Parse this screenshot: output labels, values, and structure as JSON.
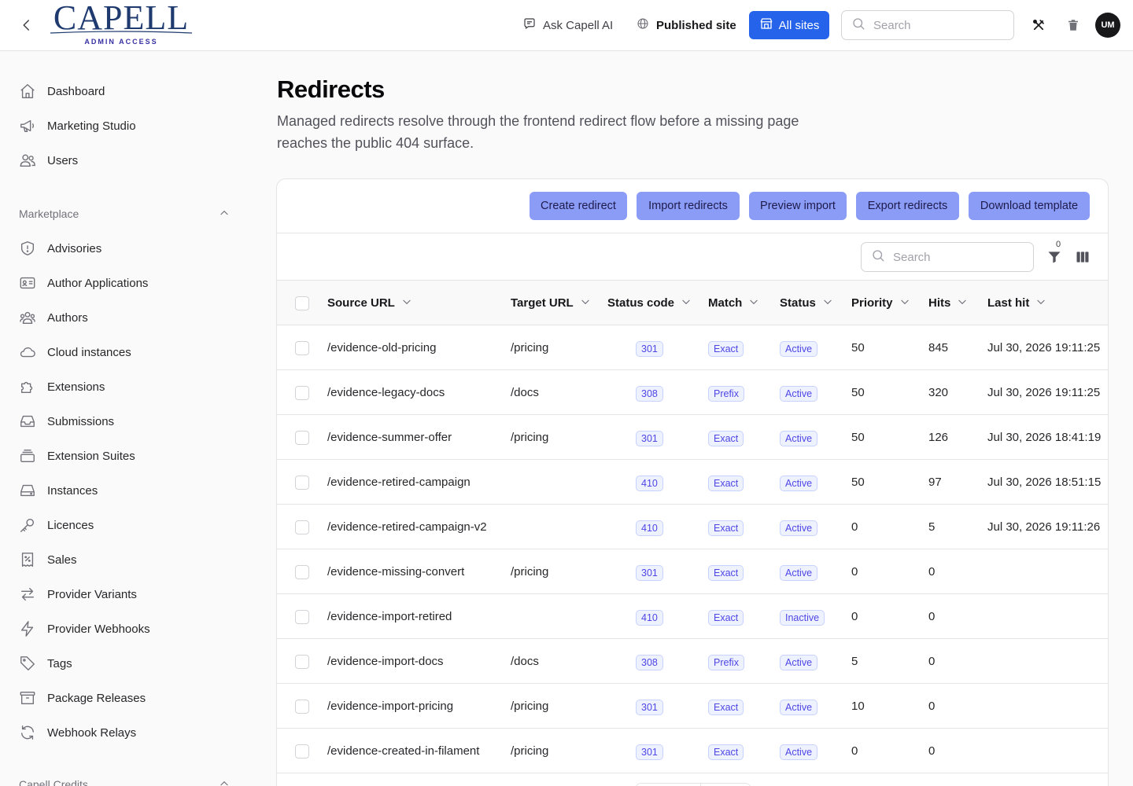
{
  "header": {
    "logo_text": "CAPELL",
    "logo_sub": "ADMIN ACCESS",
    "ask_ai_label": "Ask Capell AI",
    "published_site_label": "Published site",
    "all_sites_label": "All sites",
    "search_placeholder": "Search",
    "avatar_initials": "UM"
  },
  "sidebar": {
    "top_items": [
      {
        "label": "Dashboard",
        "icon": "home-icon"
      },
      {
        "label": "Marketing Studio",
        "icon": "megaphone-icon"
      },
      {
        "label": "Users",
        "icon": "users-icon"
      }
    ],
    "group_label": "Marketplace",
    "group_items": [
      {
        "label": "Advisories",
        "icon": "shield-icon"
      },
      {
        "label": "Author Applications",
        "icon": "id-card-icon"
      },
      {
        "label": "Authors",
        "icon": "user-group-icon"
      },
      {
        "label": "Cloud instances",
        "icon": "cloud-icon"
      },
      {
        "label": "Extensions",
        "icon": "puzzle-icon"
      },
      {
        "label": "Submissions",
        "icon": "inbox-icon"
      },
      {
        "label": "Extension Suites",
        "icon": "stack-icon"
      },
      {
        "label": "Instances",
        "icon": "server-icon"
      },
      {
        "label": "Licences",
        "icon": "key-icon"
      },
      {
        "label": "Sales",
        "icon": "receipt-percent-icon"
      },
      {
        "label": "Provider Variants",
        "icon": "arrows-right-left-icon"
      },
      {
        "label": "Provider Webhooks",
        "icon": "bolt-icon"
      },
      {
        "label": "Tags",
        "icon": "tag-icon"
      },
      {
        "label": "Package Releases",
        "icon": "archive-box-icon"
      },
      {
        "label": "Webhook Relays",
        "icon": "refresh-icon"
      }
    ],
    "group2_label": "Capell Credits"
  },
  "page": {
    "title": "Redirects",
    "description": "Managed redirects resolve through the frontend redirect flow before a missing page reaches the public 404 surface."
  },
  "actions": {
    "create": "Create redirect",
    "import": "Import redirects",
    "preview": "Preview import",
    "export": "Export redirects",
    "template": "Download template"
  },
  "table": {
    "search_placeholder": "Search",
    "filter_count": "0",
    "columns": [
      "Source URL",
      "Target URL",
      "Status code",
      "Match",
      "Status",
      "Priority",
      "Hits",
      "Last hit"
    ],
    "rows": [
      {
        "source": "/evidence-old-pricing",
        "target": "/pricing",
        "code": "301",
        "match": "Exact",
        "status": "Active",
        "priority": "50",
        "hits": "845",
        "last_hit": "Jul 30, 2026 19:11:25"
      },
      {
        "source": "/evidence-legacy-docs",
        "target": "/docs",
        "code": "308",
        "match": "Prefix",
        "status": "Active",
        "priority": "50",
        "hits": "320",
        "last_hit": "Jul 30, 2026 19:11:25"
      },
      {
        "source": "/evidence-summer-offer",
        "target": "/pricing",
        "code": "301",
        "match": "Exact",
        "status": "Active",
        "priority": "50",
        "hits": "126",
        "last_hit": "Jul 30, 2026 18:41:19"
      },
      {
        "source": "/evidence-retired-campaign",
        "target": "",
        "code": "410",
        "match": "Exact",
        "status": "Active",
        "priority": "50",
        "hits": "97",
        "last_hit": "Jul 30, 2026 18:51:15"
      },
      {
        "source": "/evidence-retired-campaign-v2",
        "target": "",
        "code": "410",
        "match": "Exact",
        "status": "Active",
        "priority": "0",
        "hits": "5",
        "last_hit": "Jul 30, 2026 19:11:26"
      },
      {
        "source": "/evidence-missing-convert",
        "target": "/pricing",
        "code": "301",
        "match": "Exact",
        "status": "Active",
        "priority": "0",
        "hits": "0",
        "last_hit": ""
      },
      {
        "source": "/evidence-import-retired",
        "target": "",
        "code": "410",
        "match": "Exact",
        "status": "Inactive",
        "priority": "0",
        "hits": "0",
        "last_hit": ""
      },
      {
        "source": "/evidence-import-docs",
        "target": "/docs",
        "code": "308",
        "match": "Prefix",
        "status": "Active",
        "priority": "5",
        "hits": "0",
        "last_hit": ""
      },
      {
        "source": "/evidence-import-pricing",
        "target": "/pricing",
        "code": "301",
        "match": "Exact",
        "status": "Active",
        "priority": "10",
        "hits": "0",
        "last_hit": ""
      },
      {
        "source": "/evidence-created-in-filament",
        "target": "/pricing",
        "code": "301",
        "match": "Exact",
        "status": "Active",
        "priority": "0",
        "hits": "0",
        "last_hit": ""
      }
    ]
  },
  "colors": {
    "accent": "#2563eb",
    "action_button": "#8b9cf7",
    "badge_text": "#4f46e5"
  }
}
